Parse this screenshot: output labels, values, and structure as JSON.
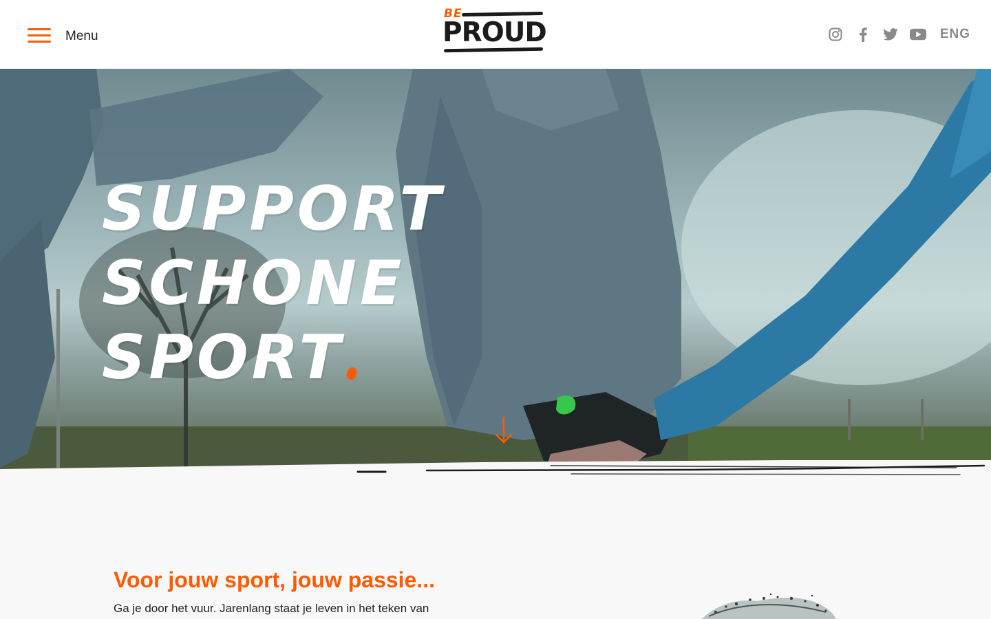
{
  "header": {
    "menu_label": "Menu",
    "logo": {
      "small": "BE",
      "main": "PROUD"
    },
    "social": [
      {
        "icon": "instagram-icon"
      },
      {
        "icon": "facebook-icon"
      },
      {
        "icon": "twitter-icon"
      },
      {
        "icon": "youtube-icon"
      }
    ],
    "language": "ENG"
  },
  "hero": {
    "title_lines": [
      "SUPPORT",
      "SCHONE",
      "SPORT"
    ],
    "scroll_icon": "arrow-down-icon"
  },
  "intro": {
    "title": "Voor jouw sport, jouw passie...",
    "text": "Ga je door het vuur. Jarenlang staat je leven in het teken van"
  },
  "colors": {
    "accent": "#ff5a00",
    "text": "#222222",
    "icon_gray": "#8a8a8a",
    "background": "#f8f8f8"
  }
}
